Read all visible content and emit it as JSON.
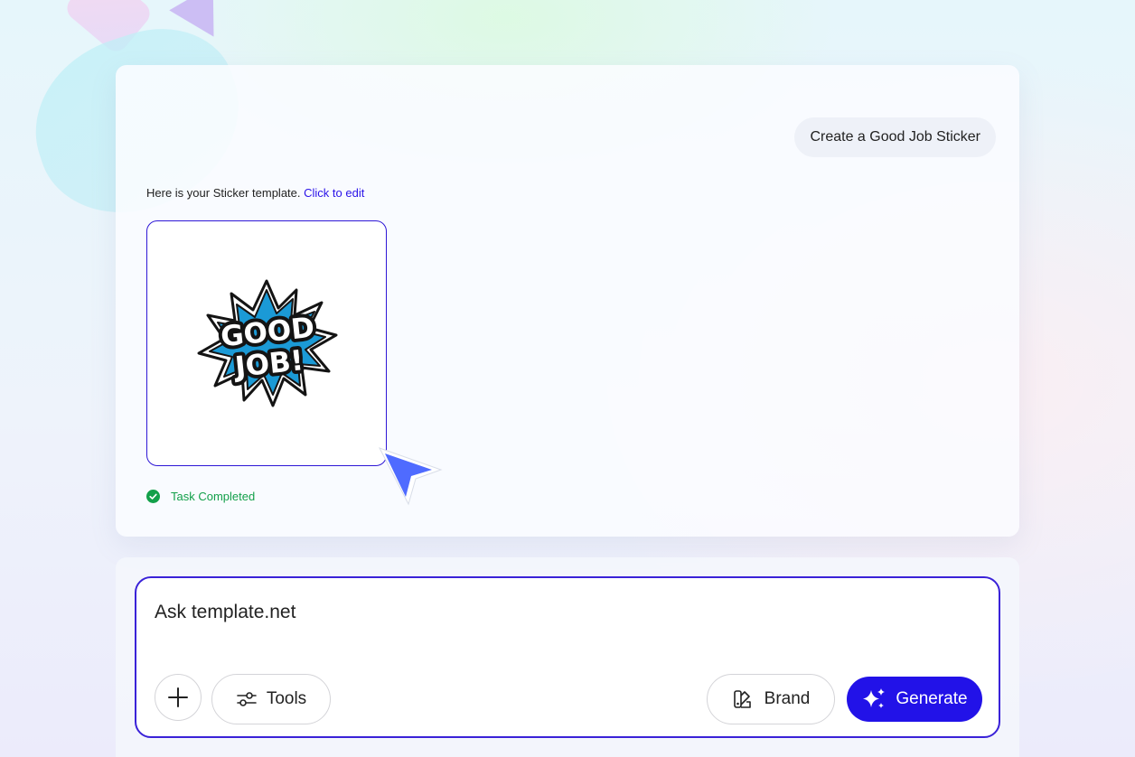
{
  "chat": {
    "user_message": "Create a Good Job Sticker",
    "intro_text": "Here is your Sticker template. ",
    "intro_link": "Click to edit",
    "sticker": {
      "line1": "GOOD",
      "line2": "JOB!",
      "colors": {
        "burst": "#1b9ad6",
        "outline": "#141414",
        "text": "#ffffff"
      }
    },
    "status": "Task Completed"
  },
  "composer": {
    "placeholder": "Ask template.net",
    "tools_label": "Tools",
    "brand_label": "Brand",
    "generate_label": "Generate",
    "add_icon": "plus-icon"
  },
  "theme": {
    "accent": "#2212e8",
    "success": "#13a04a",
    "cursor": "#4f6bff"
  }
}
